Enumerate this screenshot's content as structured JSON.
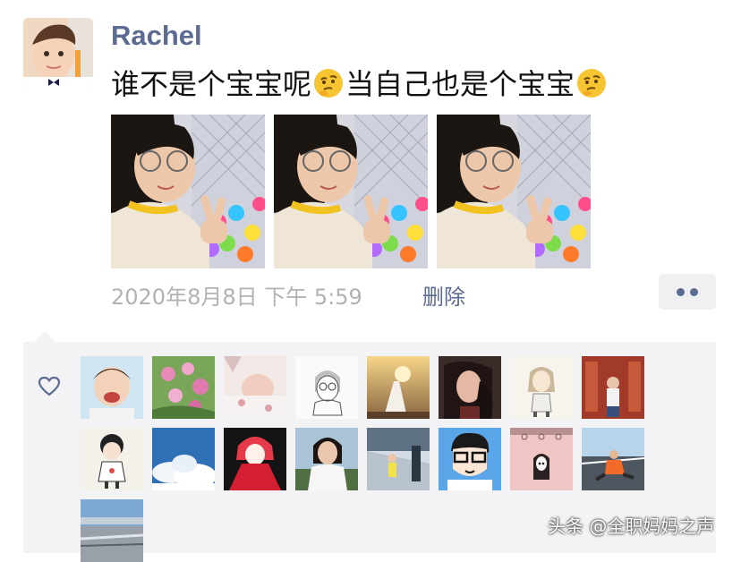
{
  "post": {
    "username": "Rachel",
    "text_part1": "谁不是个宝宝呢",
    "text_part2": "当自己也是个宝宝",
    "emoji_name": "thinking-face-icon",
    "time": "2020年8月8日 下午 5:59",
    "delete_label": "删除",
    "photo_count": 3
  },
  "likes": {
    "count": 17
  },
  "watermark": "头条 @全职妈妈之声",
  "colors": {
    "link_blue": "#5b6b91",
    "meta_gray": "#b2b2b2",
    "panel_bg": "#f3f3f5"
  }
}
